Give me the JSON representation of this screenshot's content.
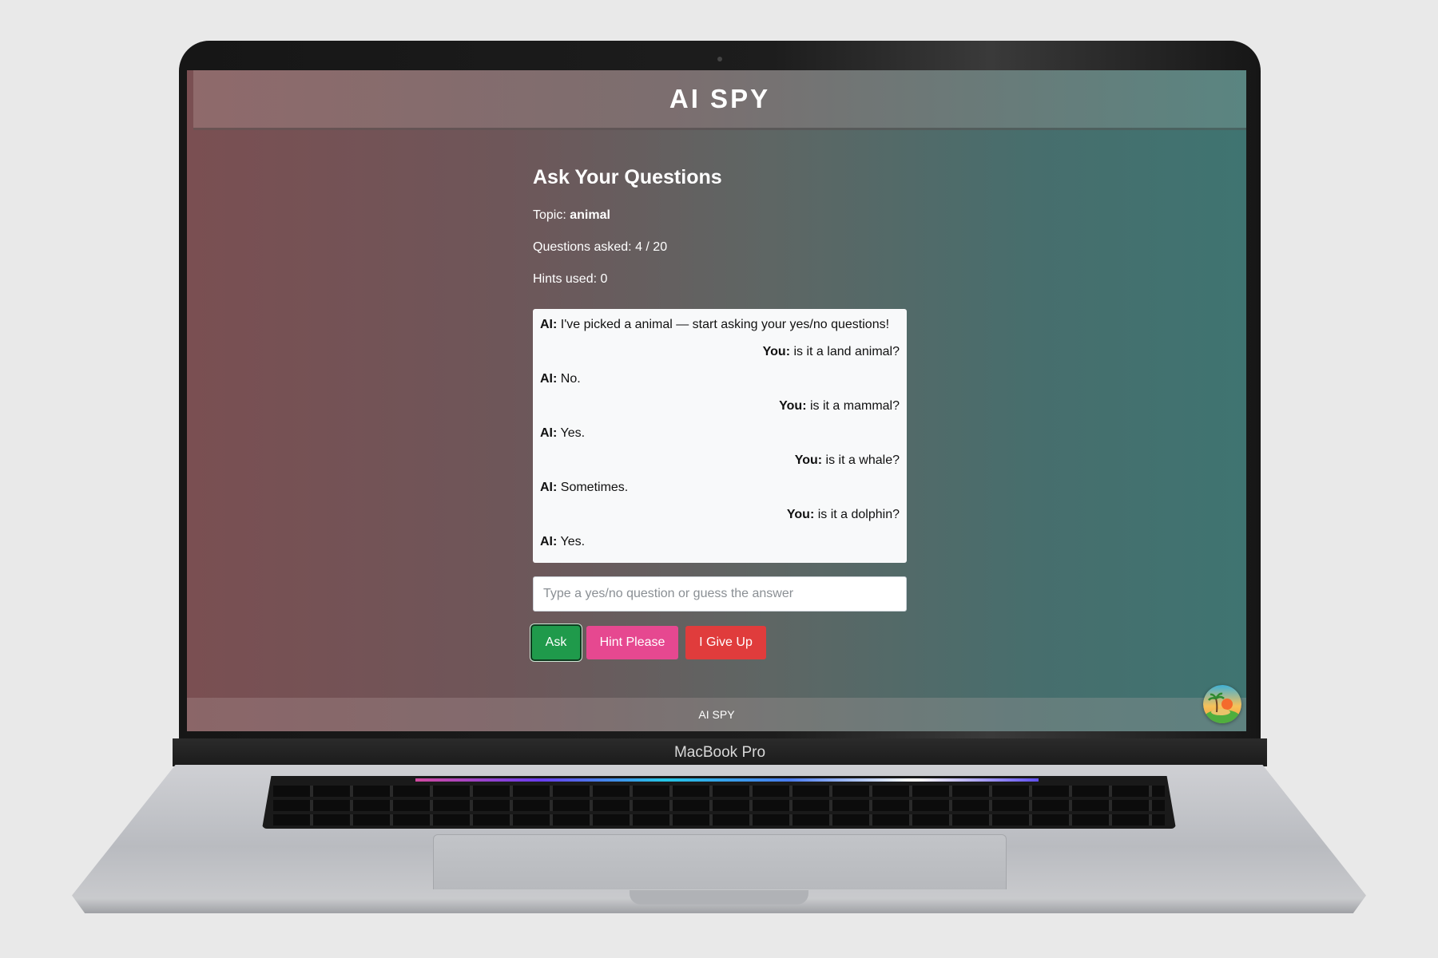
{
  "device": {
    "brand_label": "MacBook Pro"
  },
  "app": {
    "header_title": "AI SPY",
    "footer_text": "AI SPY"
  },
  "page": {
    "title": "Ask Your Questions",
    "topic_label": "Topic:",
    "topic_value": "animal",
    "questions_label": "Questions asked: 4 / 20",
    "hints_label": "Hints used: 0"
  },
  "chat": {
    "messages": [
      {
        "speaker": "AI:",
        "text": " I've picked a animal — start asking your yes/no questions!"
      },
      {
        "speaker": "You:",
        "text": " is it a land animal?"
      },
      {
        "speaker": "AI:",
        "text": " No."
      },
      {
        "speaker": "You:",
        "text": " is it a mammal?"
      },
      {
        "speaker": "AI:",
        "text": " Yes."
      },
      {
        "speaker": "You:",
        "text": " is it a whale?"
      },
      {
        "speaker": "AI:",
        "text": " Sometimes."
      },
      {
        "speaker": "You:",
        "text": " is it a dolphin?"
      },
      {
        "speaker": "AI:",
        "text": " Yes."
      }
    ]
  },
  "input": {
    "placeholder": "Type a yes/no question or guess the answer",
    "value": ""
  },
  "buttons": {
    "ask": "Ask",
    "hint": "Hint Please",
    "give_up": "I Give Up"
  },
  "colors": {
    "ask_button": "#1f9a4b",
    "hint_button": "#e64890",
    "give_up_button": "#e03c3c"
  },
  "icons": {
    "avatar": "palm-island-avatar-icon"
  }
}
